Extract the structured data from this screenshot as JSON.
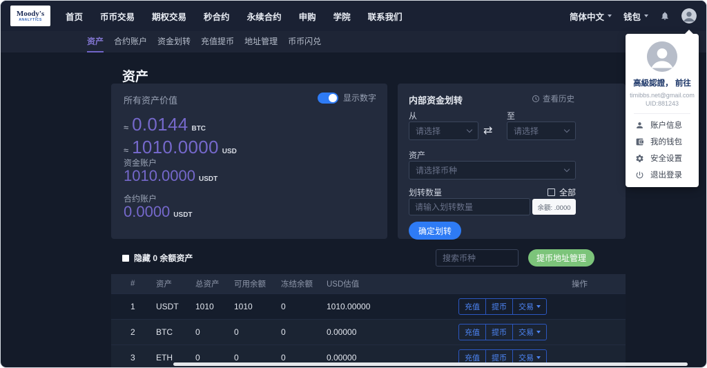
{
  "colors": {
    "accent_purple": "#7568cb",
    "accent_blue": "#2e7bf5",
    "accent_green": "#7cc47a",
    "navbar_bg": "#1a2133",
    "panel_bg": "#232b3d"
  },
  "navbar": {
    "logo_line1": "Moody's",
    "logo_line2": "ANALYTICS",
    "items": [
      "首页",
      "币币交易",
      "期权交易",
      "秒合约",
      "永续合约",
      "申购",
      "学院",
      "联系我们"
    ],
    "language": "简体中文",
    "wallet": "钱包"
  },
  "subnav": {
    "items": [
      "资产",
      "合约账户",
      "资金划转",
      "充值提币",
      "地址管理",
      "币币闪兑"
    ]
  },
  "page": {
    "title": "资产"
  },
  "assets_panel": {
    "title": "所有资产价值",
    "toggle_label": "显示数字",
    "totals": [
      {
        "approx": "≈",
        "value": "0.0144",
        "unit": "BTC"
      },
      {
        "approx": "≈",
        "value": "1010.0000",
        "unit": "USD"
      }
    ],
    "accounts": [
      {
        "label": "资金账户",
        "value": "1010.0000",
        "unit": "USDT"
      },
      {
        "label": "合约账户",
        "value": "0.0000",
        "unit": "USDT"
      }
    ]
  },
  "transfer_panel": {
    "title": "内部资金划转",
    "history_label": "查看历史",
    "from_label": "从",
    "to_label": "至",
    "select_placeholder": "请选择",
    "asset_label": "资产",
    "asset_placeholder": "请选择币种",
    "amount_label": "划转数量",
    "all_label": "全部",
    "amount_placeholder": "请输入划转数量",
    "balance_label": "余额: .0000",
    "submit_label": "确定划转"
  },
  "toolbar": {
    "hide_zero_label": "隐藏 0 余额资产",
    "search_placeholder": "搜索币种",
    "address_button": "提币地址管理"
  },
  "table": {
    "headers": [
      "#",
      "资产",
      "总资产",
      "可用余额",
      "冻结余额",
      "USD估值",
      "操作"
    ],
    "rows": [
      {
        "index": "1",
        "asset": "USDT",
        "total": "1010",
        "available": "1010",
        "frozen": "0",
        "usd_value": "1010.00000"
      },
      {
        "index": "2",
        "asset": "BTC",
        "total": "0",
        "available": "0",
        "frozen": "0",
        "usd_value": "0.00000"
      },
      {
        "index": "3",
        "asset": "ETH",
        "total": "0",
        "available": "0",
        "frozen": "0",
        "usd_value": "0.00000"
      }
    ],
    "actions": {
      "deposit": "充值",
      "withdraw": "提币",
      "trade": "交易"
    }
  },
  "user_menu": {
    "verify_text": "高級認證， 前往",
    "email": "timibbs.net@gmail.com",
    "uid": "UID:881243",
    "items": [
      "账户信息",
      "我的钱包",
      "安全设置",
      "退出登录"
    ]
  }
}
